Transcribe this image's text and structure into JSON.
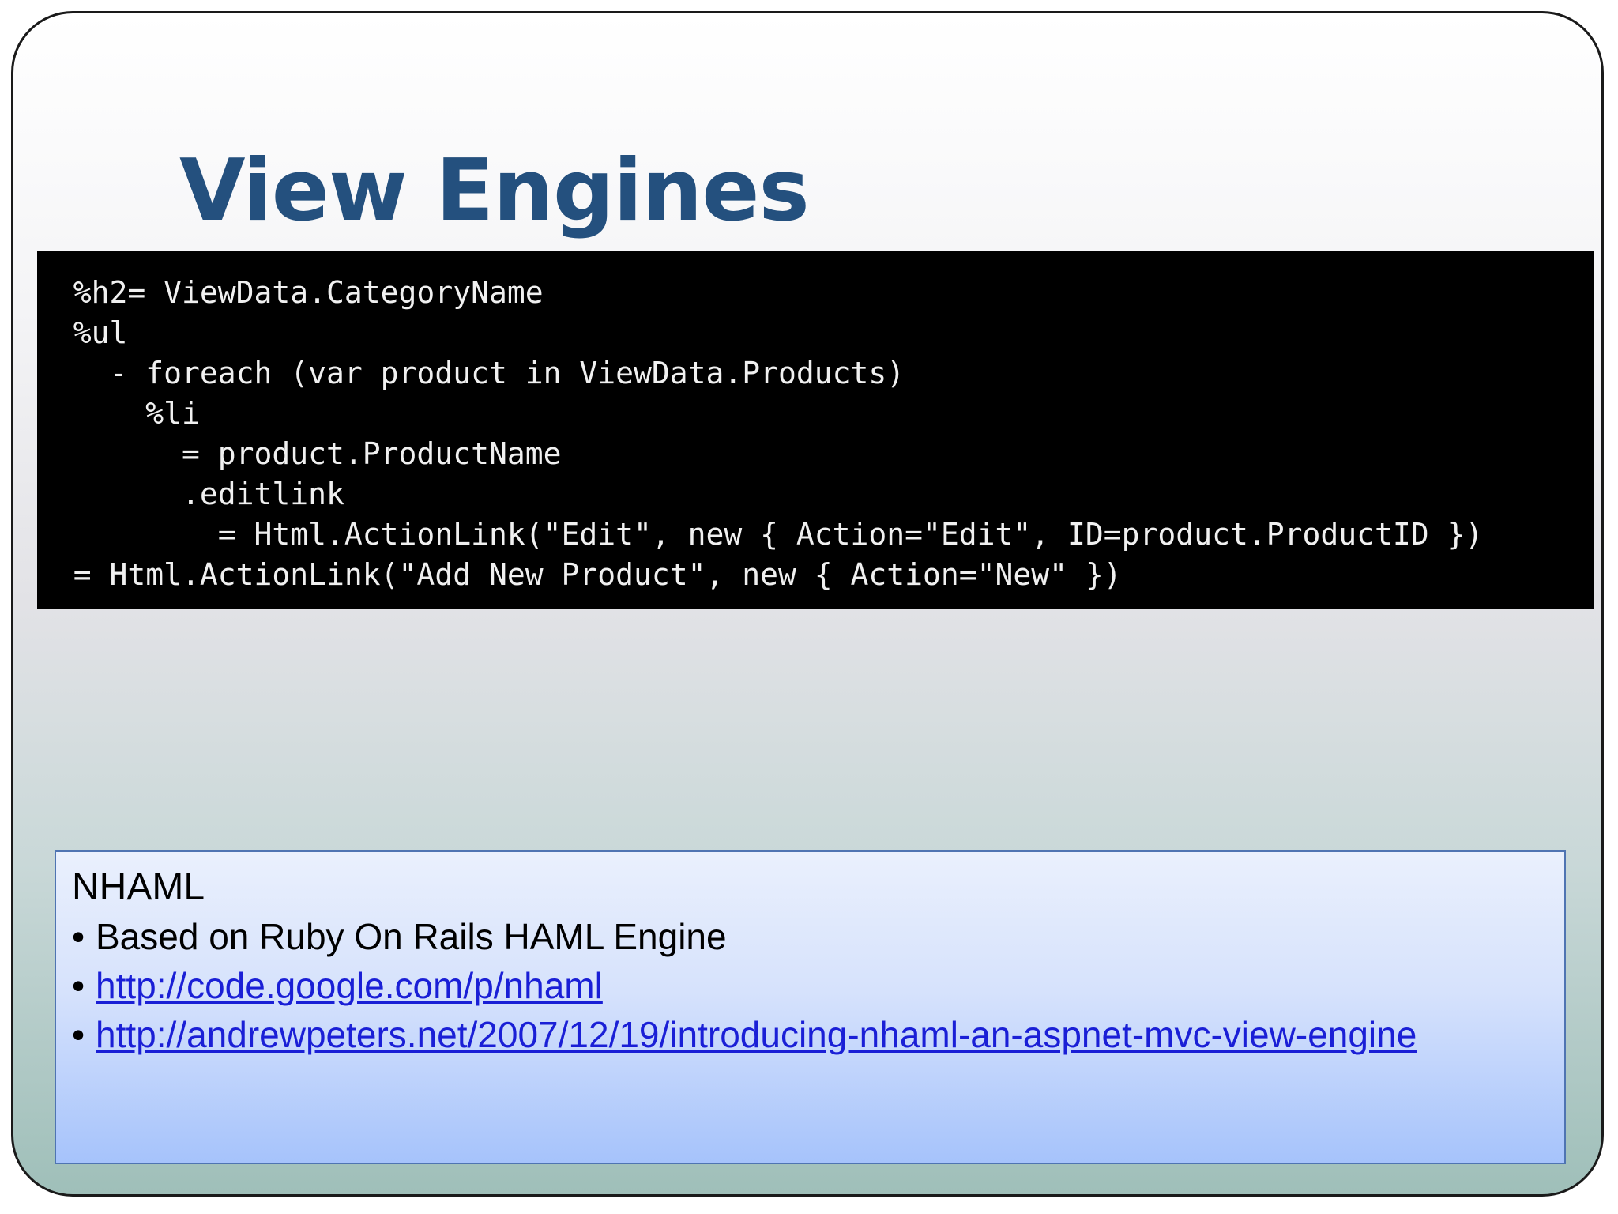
{
  "slide": {
    "title": "View Engines",
    "code_lines": [
      "  %h2= ViewData.CategoryName",
      "  %ul",
      "    - foreach (var product in ViewData.Products)",
      "      %li",
      "        = product.ProductName",
      "        .editlink",
      "          = Html.ActionLink(\"Edit\", new { Action=\"Edit\", ID=product.ProductID })",
      "  = Html.ActionLink(\"Add New Product\", new { Action=\"New\" })"
    ],
    "info_box": {
      "heading": "NHAML",
      "bullet_symbol": "•",
      "items": [
        {
          "text": "Based on Ruby On Rails HAML Engine"
        },
        {
          "link": "http://code.google.com/p/nhaml"
        },
        {
          "link": "http://andrewpeters.net/2007/12/19/introducing-nhaml-an-aspnet-mvc-view-engine"
        }
      ]
    }
  },
  "colors": {
    "title": "#24507e",
    "code_background": "#000000",
    "code_text": "#f0f0f0",
    "info_border": "#4f74b2",
    "link": "#1a1fd6"
  }
}
